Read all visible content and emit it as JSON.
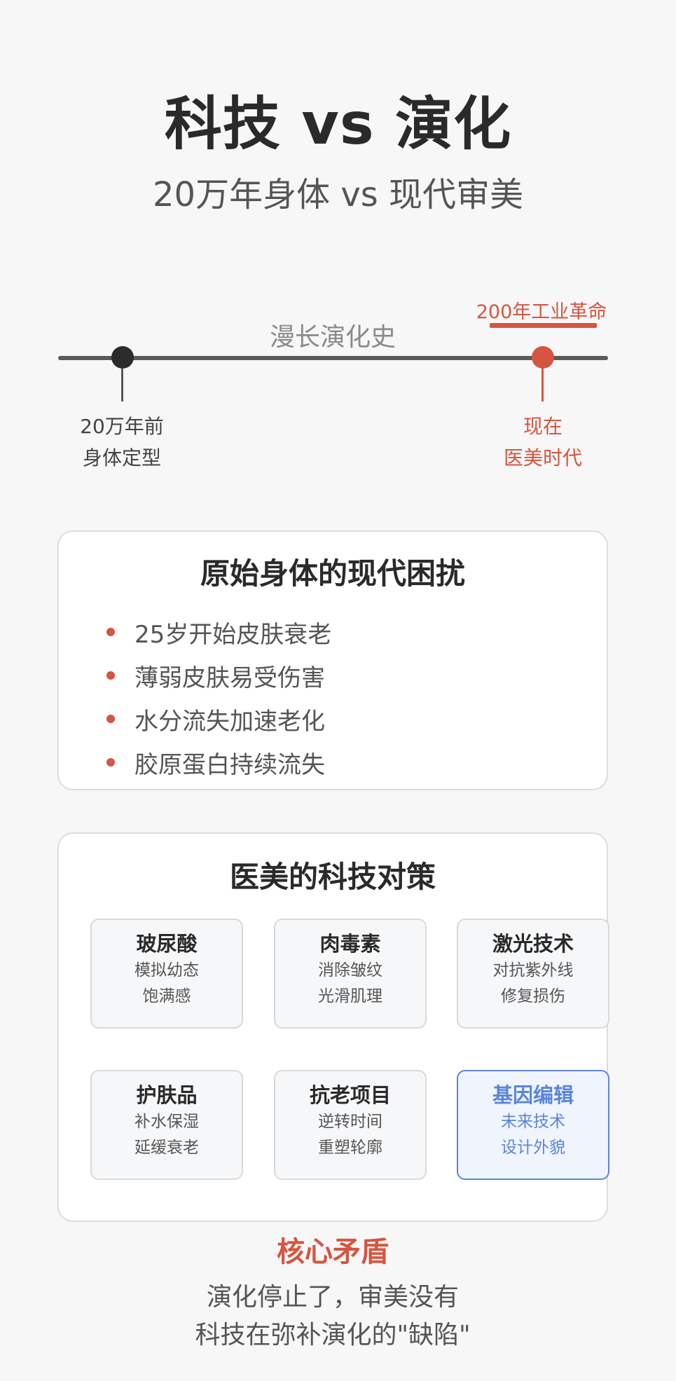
{
  "header": {
    "title": "科技 vs 演化",
    "subtitle": "20万年身体 vs 现代审美"
  },
  "timeline": {
    "middle_label": "漫长演化史",
    "left_label_line1": "20万年前",
    "left_label_line2": "身体定型",
    "right_label_line1": "现在",
    "right_label_line2": "医美时代",
    "industrial_label": "200年工业革命"
  },
  "problems": {
    "title": "原始身体的现代困扰",
    "items": [
      "25岁开始皮肤衰老",
      "薄弱皮肤易受伤害",
      "水分流失加速老化",
      "胶原蛋白持续流失"
    ]
  },
  "tech": {
    "title": "医美的科技对策",
    "items": [
      {
        "name": "玻尿酸",
        "line1": "模拟幼态",
        "line2": "饱满感"
      },
      {
        "name": "肉毒素",
        "line1": "消除皱纹",
        "line2": "光滑肌理"
      },
      {
        "name": "激光技术",
        "line1": "对抗紫外线",
        "line2": "修复损伤"
      },
      {
        "name": "护肤品",
        "line1": "补水保湿",
        "line2": "延缓衰老"
      },
      {
        "name": "抗老项目",
        "line1": "逆转时间",
        "line2": "重塑轮廓"
      },
      {
        "name": "基因编辑",
        "line1": "未来技术",
        "line2": "设计外貌"
      }
    ]
  },
  "conclusion": {
    "title": "核心矛盾",
    "line1": "演化停止了，审美没有",
    "line2": "科技在弥补演化的\"缺陷\""
  },
  "colors": {
    "accent": "#d65541",
    "highlight_blue": "#5b86d8",
    "background": "#f7f7f7"
  }
}
